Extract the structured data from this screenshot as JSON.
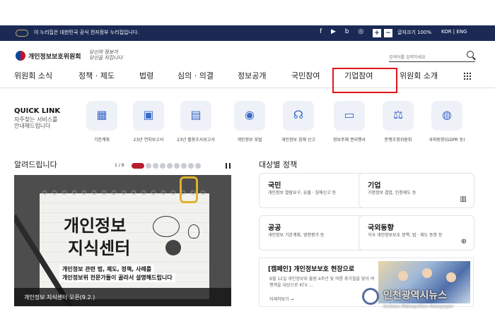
{
  "govbar": {
    "notice": "이 누리집은 대한민국 공식 전자정부 누리집입니다.",
    "sns": "f ▶ b ◎",
    "zoom_in": "+",
    "zoom_out": "−",
    "zoom_label": "글자크기 100%",
    "lang": "KOR | ENG"
  },
  "header": {
    "logo": "개인정보보호위원회",
    "slogan": "당신의 정보가 당신을 지킵니다",
    "search_placeholder": "검색어를 입력하세요"
  },
  "gnb": {
    "items": [
      "위원회 소식",
      "정책 · 제도",
      "법령",
      "심의 · 의결",
      "정보공개",
      "국민참여",
      "기업참여",
      "위원회 소개"
    ]
  },
  "quicklink": {
    "title": "QUICK LINK",
    "subtitle": "자주찾는 서비스를 안내해드립니다",
    "items": [
      {
        "label": "기본계획",
        "icon": "calendar-icon"
      },
      {
        "label": "23년 연차보고서",
        "icon": "report-icon"
      },
      {
        "label": "23년 활용조사보고서",
        "icon": "document-icon"
      },
      {
        "label": "개인정보 포털",
        "icon": "portal-icon"
      },
      {
        "label": "개인정보 침해 신고",
        "icon": "headset-icon"
      },
      {
        "label": "정보주체 권리행사",
        "icon": "id-card-icon"
      },
      {
        "label": "분쟁조정위원회",
        "icon": "mediation-icon"
      },
      {
        "label": "국외동향(GDPR 등)",
        "icon": "globe-icon"
      }
    ]
  },
  "notice": {
    "title": "알려드립니다",
    "pager": "1 / 9",
    "banner_line1": "개인정보",
    "banner_line2": "지식센터",
    "banner_desc1": "개인정보 관련 법, 제도, 정책, 사례를",
    "banner_desc2": "개인정보위 전문가들이 골라서 설명해드립니다",
    "caption": "개인정보 지식센터 오픈(9.2.)"
  },
  "policy": {
    "title": "대상별 정책",
    "cards": [
      {
        "title": "국민",
        "desc": "개인정보 열람요구, 유출 · 침해신고 등",
        "icon": "person-icon"
      },
      {
        "title": "기업",
        "desc": "가명정보 결합, 인증제도 등",
        "icon": "building-icon"
      },
      {
        "title": "공공",
        "desc": "개인정보 기본계획, 영향평가 등",
        "icon": "government-icon"
      },
      {
        "title": "국외동향",
        "desc": "각국 개인정보보호 정책, 법 · 제도 동향 등",
        "icon": "globe-icon"
      }
    ],
    "campaign_title": "[캠페인] 개인정보보호 현장으로",
    "campaign_desc": "8월 12일 개인정보위 출범 4주년 및 여름 휴가철을 맞아 여행객을 대상으로 KTX ...",
    "campaign_more": "자세히보기 →"
  },
  "watermark": {
    "korean": "인천광역시뉴스",
    "english": "Incheon Metropolitan Newspaper"
  },
  "colors": {
    "govbar": "#1b2a55",
    "highlight": "#e0151a",
    "accent": "#b91c2d"
  }
}
